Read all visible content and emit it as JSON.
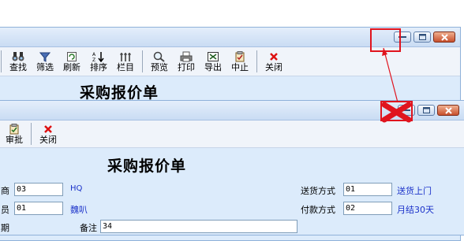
{
  "window1": {
    "toolbar": [
      {
        "id": "find",
        "label": "查找",
        "icon": "binoculars-icon"
      },
      {
        "id": "filter",
        "label": "筛选",
        "icon": "funnel-icon"
      },
      {
        "id": "refresh",
        "label": "刷新",
        "icon": "refresh-icon"
      },
      {
        "id": "sort",
        "label": "排序",
        "icon": "sort-icon"
      },
      {
        "id": "columns",
        "label": "栏目",
        "icon": "columns-icon"
      },
      {
        "id": "preview",
        "label": "预览",
        "icon": "magnifier-icon"
      },
      {
        "id": "print",
        "label": "打印",
        "icon": "printer-icon"
      },
      {
        "id": "export",
        "label": "导出",
        "icon": "export-icon"
      },
      {
        "id": "stop",
        "label": "中止",
        "icon": "stop-icon"
      },
      {
        "id": "close",
        "label": "关闭",
        "icon": "close-x-icon"
      }
    ],
    "title": "采购报价单"
  },
  "window2": {
    "toolbar": [
      {
        "id": "approve",
        "label": "审批",
        "icon": "clipboard-check-icon"
      },
      {
        "id": "close",
        "label": "关闭",
        "icon": "close-x-icon"
      }
    ],
    "title": "采购报价单",
    "fields": {
      "supplier": {
        "label": "商",
        "value": "03",
        "display": "HQ"
      },
      "staff": {
        "label": "员",
        "value": "01",
        "display": "魏叭"
      },
      "date": {
        "label": "期"
      },
      "remark": {
        "label": "备注",
        "value": "34"
      },
      "delivery": {
        "label": "送货方式",
        "value": "01",
        "display": "送货上门"
      },
      "payment": {
        "label": "付款方式",
        "value": "02",
        "display": "月结30天"
      }
    }
  },
  "colors": {
    "highlight": "#e0141e",
    "link_value": "#1a31c9"
  }
}
